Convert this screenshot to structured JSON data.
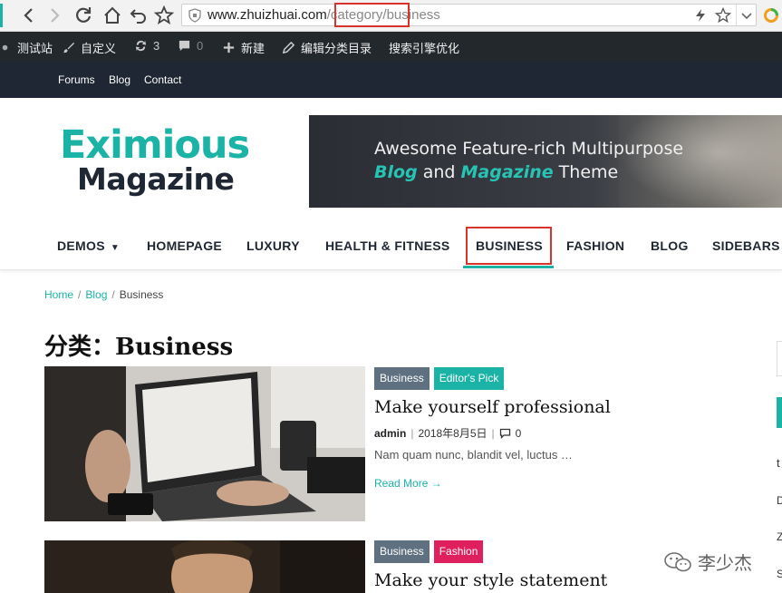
{
  "browser": {
    "url_host": "www.zhuizhuai.com",
    "url_path_a": "/category/",
    "url_path_b": "business"
  },
  "admin_bar": {
    "site_name": "测试站",
    "customize": "自定义",
    "updates_count": "3",
    "comments_count": "0",
    "new": "新建",
    "edit_category": "编辑分类目录",
    "seo": "搜索引擎优化"
  },
  "top_bar": {
    "links": [
      "Forums",
      "Blog",
      "Contact"
    ]
  },
  "header": {
    "logo_top": "Eximious",
    "logo_bottom": "Magazine",
    "banner_line1": "Awesome Feature-rich Multipurpose",
    "banner_blog": "Blog",
    "banner_and": " and ",
    "banner_magazine": "Magazine",
    "banner_theme": " Theme"
  },
  "main_nav": {
    "items": [
      "DEMOS",
      "HOMEPAGE",
      "LUXURY",
      "HEALTH & FITNESS",
      "BUSINESS",
      "FASHION",
      "BLOG",
      "SIDEBARS"
    ],
    "active": "BUSINESS"
  },
  "breadcrumb": {
    "home": "Home",
    "sep": "/",
    "blog": "Blog",
    "current": "Business"
  },
  "page_title": "分类：Business",
  "posts": [
    {
      "categories": [
        "Business",
        "Editor's Pick"
      ],
      "title": "Make yourself professional",
      "author": "admin",
      "date": "2018年8月5日",
      "comments": "0",
      "excerpt": "Nam quam nunc, blandit vel, luctus …",
      "read_more": "Read More →"
    },
    {
      "categories": [
        "Business",
        "Fashion"
      ],
      "title": "Make your style statement"
    }
  ],
  "sidebar_chars": [
    "t",
    "D",
    "Z",
    "S"
  ],
  "watermark": "李少杰",
  "colors": {
    "accent": "#1ab3a6",
    "dark": "#1e2733",
    "admin_bar": "#23282d",
    "highlight_box": "#d9342b",
    "fashion_tag": "#e0205e",
    "business_tag": "#5f7180"
  }
}
